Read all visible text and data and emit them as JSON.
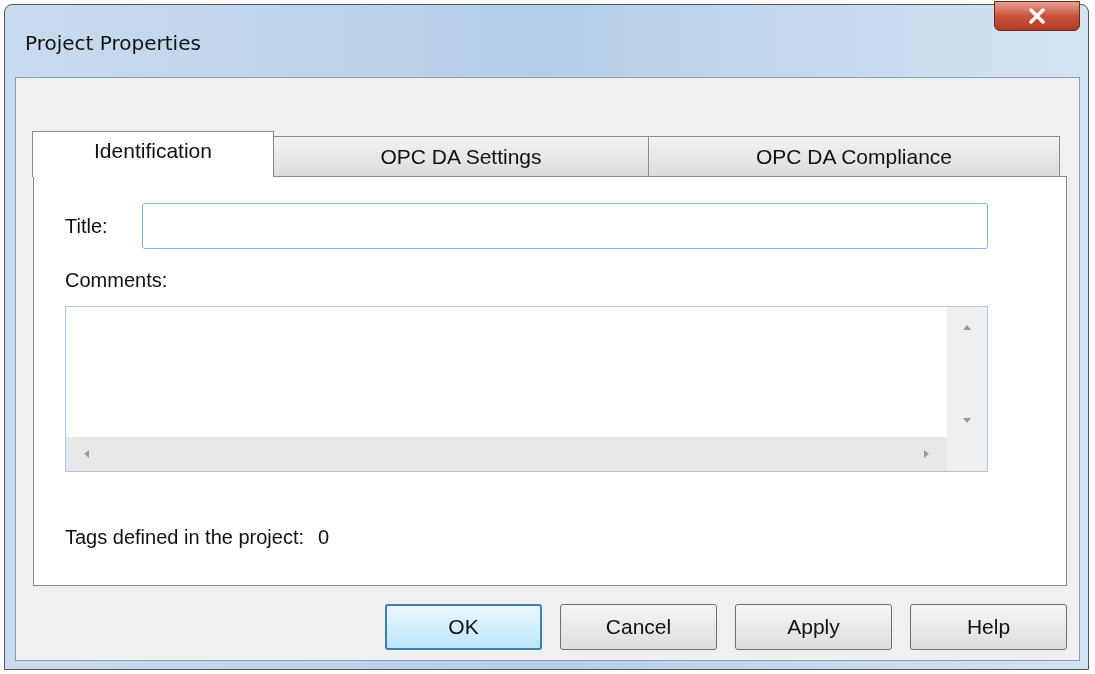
{
  "window": {
    "title": "Project Properties"
  },
  "tabs": [
    {
      "label": "Identification",
      "selected": true
    },
    {
      "label": "OPC DA Settings",
      "selected": false
    },
    {
      "label": "OPC DA Compliance",
      "selected": false
    }
  ],
  "form": {
    "title_label": "Title:",
    "comments_label": "Comments:",
    "tags_label": "Tags defined in the project:",
    "tags_count": "0"
  },
  "buttons": [
    {
      "label": "OK",
      "default": true
    },
    {
      "label": "Cancel",
      "default": false
    },
    {
      "label": "Apply",
      "default": false
    },
    {
      "label": "Help",
      "default": false
    }
  ]
}
